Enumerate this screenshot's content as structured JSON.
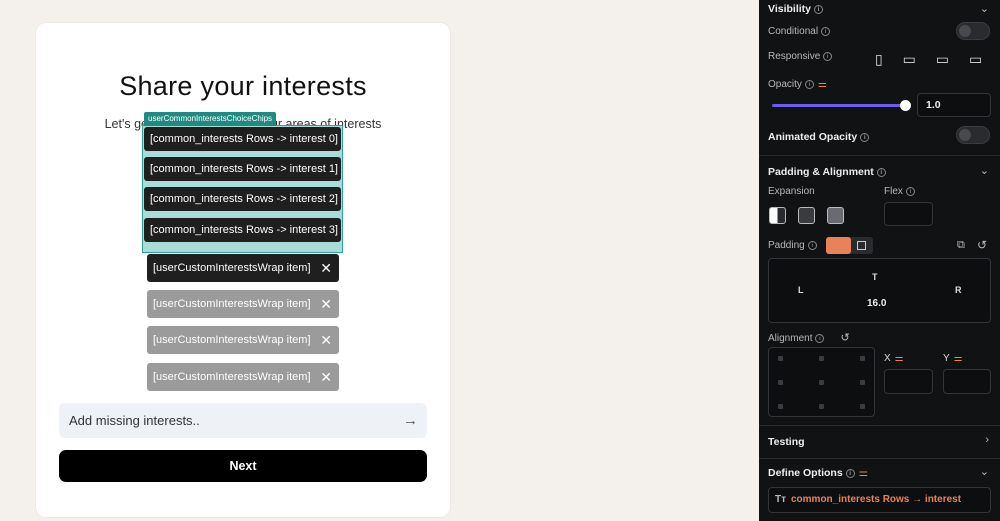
{
  "canvas": {
    "title": "Share your interests",
    "subtitle": "Let's get started by sharing your areas of interests",
    "selected_widget_tag": "userCommonInterestsChoiceChips",
    "common_chips": [
      "[common_interests Rows -> interest 0]",
      "[common_interests Rows -> interest 1]",
      "[common_interests Rows -> interest 2]",
      "[common_interests Rows -> interest 3]"
    ],
    "custom_chips": [
      "[userCustomInterestsWrap item]",
      "[userCustomInterestsWrap item]",
      "[userCustomInterestsWrap item]",
      "[userCustomInterestsWrap item]"
    ],
    "add_input_placeholder": "Add missing interests..",
    "next_label": "Next"
  },
  "panel": {
    "visibility_title": "Visibility",
    "conditional_label": "Conditional",
    "responsive_label": "Responsive",
    "opacity_label": "Opacity",
    "opacity_value": "1.0",
    "animated_opacity_label": "Animated Opacity",
    "padding_alignment_title": "Padding & Alignment",
    "expansion_label": "Expansion",
    "flex_label": "Flex",
    "padding_label": "Padding",
    "pad_top": "T",
    "pad_left": "L",
    "pad_right": "R",
    "pad_value": "16.0",
    "alignment_label": "Alignment",
    "x_label": "X",
    "y_label": "Y",
    "testing_title": "Testing",
    "define_options_title": "Define Options",
    "option_value": "common_interests Rows → interest",
    "accent_color": "#e8825a",
    "slider_color": "#6d5bf0"
  }
}
